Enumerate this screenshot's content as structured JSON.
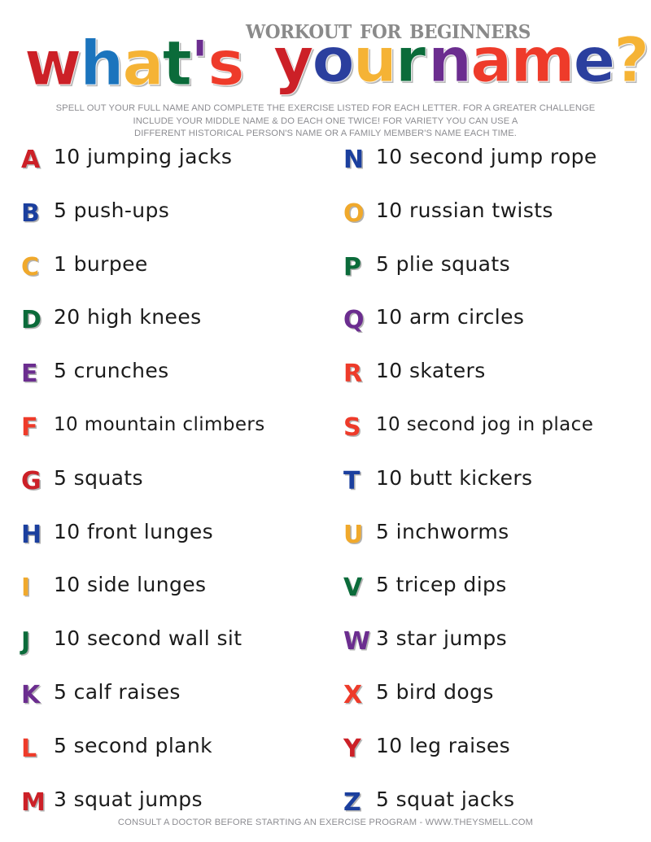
{
  "header": {
    "kicker": "Workout for Beginners",
    "wordmark": {
      "whats": [
        {
          "ch": "w",
          "color": "#cc2027"
        },
        {
          "ch": "h",
          "color": "#1b74bd"
        },
        {
          "ch": "a",
          "color": "#f5b335"
        },
        {
          "ch": "t",
          "color": "#0b6b3a"
        },
        {
          "ch": "'",
          "color": "#6b2d8f"
        },
        {
          "ch": "s",
          "color": "#ee3b2a"
        }
      ],
      "your": [
        {
          "ch": "y",
          "color": "#cc2027"
        },
        {
          "ch": "o",
          "color": "#2b3f9e"
        },
        {
          "ch": "u",
          "color": "#f5b335"
        },
        {
          "ch": "r",
          "color": "#0b6b3a"
        }
      ],
      "name": [
        {
          "ch": "n",
          "color": "#6b2d8f"
        },
        {
          "ch": "a",
          "color": "#ee3b2a"
        },
        {
          "ch": "m",
          "color": "#ee3b2a"
        },
        {
          "ch": "e",
          "color": "#2b3f9e"
        },
        {
          "ch": "?",
          "color": "#f5b335"
        }
      ]
    },
    "subtitle_lines": [
      "SPELL OUT YOUR FULL NAME AND COMPLETE THE EXERCISE LISTED FOR EACH LETTER. FOR A GREATER CHALLENGE",
      "INCLUDE YOUR MIDDLE NAME & DO EACH ONE TWICE! FOR VARIETY YOU CAN USE A",
      "DIFFERENT HISTORICAL PERSON'S NAME OR A FAMILY MEMBER'S NAME EACH TIME."
    ]
  },
  "palette": {
    "red": "#cc2027",
    "bright_red": "#ee3b2a",
    "blue": "#1b3f9e",
    "orange": "#f0a92c",
    "green": "#0b6b3a",
    "purple": "#6b2d8f",
    "gray_text": "#8d8d92",
    "ink": "#1b1b1b"
  },
  "left_column": [
    {
      "letter": "A",
      "color": "#cc2027",
      "exercise": "10 jumping jacks"
    },
    {
      "letter": "B",
      "color": "#1b3f9e",
      "exercise": "5 push-ups"
    },
    {
      "letter": "C",
      "color": "#f0a92c",
      "exercise": "1 burpee"
    },
    {
      "letter": "D",
      "color": "#0b6b3a",
      "exercise": "20 high knees"
    },
    {
      "letter": "E",
      "color": "#6b2d8f",
      "exercise": "5 crunches"
    },
    {
      "letter": "F",
      "color": "#ee3b2a",
      "exercise": "10 mountain climbers"
    },
    {
      "letter": "G",
      "color": "#cc2027",
      "exercise": "5 squats"
    },
    {
      "letter": "H",
      "color": "#1b3f9e",
      "exercise": "10 front lunges"
    },
    {
      "letter": "I",
      "color": "#f0a92c",
      "exercise": "10 side lunges"
    },
    {
      "letter": "J",
      "color": "#0b6b3a",
      "exercise": "10 second wall sit"
    },
    {
      "letter": "K",
      "color": "#6b2d8f",
      "exercise": "5 calf raises"
    },
    {
      "letter": "L",
      "color": "#ee3b2a",
      "exercise": "5 second plank"
    },
    {
      "letter": "M",
      "color": "#cc2027",
      "exercise": "3 squat jumps"
    }
  ],
  "right_column": [
    {
      "letter": "N",
      "color": "#1b3f9e",
      "exercise": "10 second jump rope"
    },
    {
      "letter": "O",
      "color": "#f0a92c",
      "exercise": "10 russian twists"
    },
    {
      "letter": "P",
      "color": "#0b6b3a",
      "exercise": "5 plie squats"
    },
    {
      "letter": "Q",
      "color": "#6b2d8f",
      "exercise": "10 arm circles"
    },
    {
      "letter": "R",
      "color": "#ee3b2a",
      "exercise": "10 skaters"
    },
    {
      "letter": "S",
      "color": "#ee3b2a",
      "exercise": "10 second jog in place"
    },
    {
      "letter": "T",
      "color": "#1b3f9e",
      "exercise": "10 butt kickers"
    },
    {
      "letter": "U",
      "color": "#f0a92c",
      "exercise": "5 inchworms"
    },
    {
      "letter": "V",
      "color": "#0b6b3a",
      "exercise": "5 tricep dips"
    },
    {
      "letter": "W",
      "color": "#6b2d8f",
      "exercise": "3 star jumps"
    },
    {
      "letter": "X",
      "color": "#ee3b2a",
      "exercise": "5 bird dogs"
    },
    {
      "letter": "Y",
      "color": "#cc2027",
      "exercise": "10 leg raises"
    },
    {
      "letter": "Z",
      "color": "#1b3f9e",
      "exercise": "5 squat jacks"
    }
  ],
  "footer": {
    "text": "CONSULT A DOCTOR BEFORE STARTING AN EXERCISE PROGRAM - WWW.THEYSMELL.COM"
  }
}
